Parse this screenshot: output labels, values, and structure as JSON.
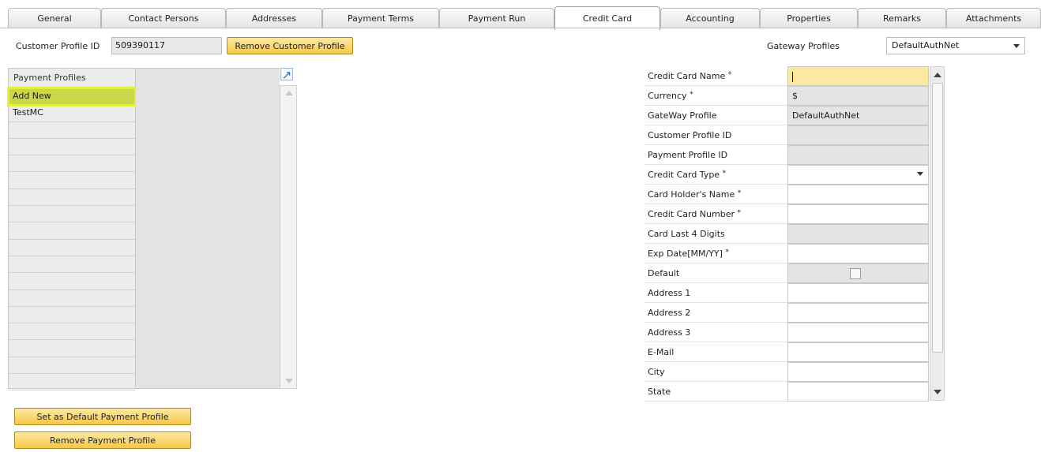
{
  "tabs": [
    {
      "label": "General",
      "active": false
    },
    {
      "label": "Contact Persons",
      "active": false
    },
    {
      "label": "Addresses",
      "active": false
    },
    {
      "label": "Payment Terms",
      "active": false
    },
    {
      "label": "Payment Run",
      "active": false
    },
    {
      "label": "Credit Card",
      "active": true
    },
    {
      "label": "Accounting",
      "active": false
    },
    {
      "label": "Properties",
      "active": false
    },
    {
      "label": "Remarks",
      "active": false
    },
    {
      "label": "Attachments",
      "active": false
    }
  ],
  "customer_profile": {
    "label": "Customer Profile ID",
    "value": "509390117",
    "remove_button": "Remove Customer Profile"
  },
  "gateway": {
    "label": "Gateway Profiles",
    "selected": "DefaultAuthNet"
  },
  "payment_profiles": {
    "header": "Payment Profiles",
    "items": [
      "Add New",
      "TestMC",
      "",
      "",
      "",
      "",
      "",
      "",
      "",
      "",
      "",
      "",
      "",
      "",
      "",
      "",
      "",
      ""
    ]
  },
  "form": {
    "rows": [
      {
        "label": "Credit Card Name",
        "required": true,
        "value": "",
        "style": "yellow"
      },
      {
        "label": "Currency",
        "required": true,
        "value": "$",
        "style": "gray"
      },
      {
        "label": "GateWay Profile",
        "required": false,
        "value": "DefaultAuthNet",
        "style": "gray"
      },
      {
        "label": "Customer Profile ID",
        "required": false,
        "value": "",
        "style": "gray"
      },
      {
        "label": "Payment Profile ID",
        "required": false,
        "value": "",
        "style": "gray"
      },
      {
        "label": "Credit Card Type",
        "required": true,
        "value": "",
        "style": "white"
      },
      {
        "label": "Card Holder's Name",
        "required": true,
        "value": "",
        "style": "white"
      },
      {
        "label": "Credit Card Number",
        "required": true,
        "value": "",
        "style": "white"
      },
      {
        "label": "Card Last 4 Digits",
        "required": false,
        "value": "",
        "style": "gray"
      },
      {
        "label": "Exp Date[MM/YY]",
        "required": true,
        "value": "",
        "style": "white"
      },
      {
        "label": "Default",
        "required": false,
        "value": "",
        "style": "gray"
      },
      {
        "label": "Address 1",
        "required": false,
        "value": "",
        "style": "white"
      },
      {
        "label": "Address 2",
        "required": false,
        "value": "",
        "style": "white"
      },
      {
        "label": "Address 3",
        "required": false,
        "value": "",
        "style": "white"
      },
      {
        "label": "E-Mail",
        "required": false,
        "value": "",
        "style": "white"
      },
      {
        "label": "City",
        "required": false,
        "value": "",
        "style": "white"
      },
      {
        "label": "State",
        "required": false,
        "value": "",
        "style": "white"
      }
    ],
    "required_mark": "*"
  },
  "buttons": {
    "set_default": "Set as Default Payment Profile",
    "remove_payment": "Remove Payment Profile"
  },
  "colors": {
    "button_fill": "#f5c84b",
    "selection_highlight": "#e5ef3a",
    "focused_field": "#fbe9a2"
  },
  "icons": {
    "expand": "expand-arrow-icon",
    "dropdown": "chevron-down-icon"
  }
}
